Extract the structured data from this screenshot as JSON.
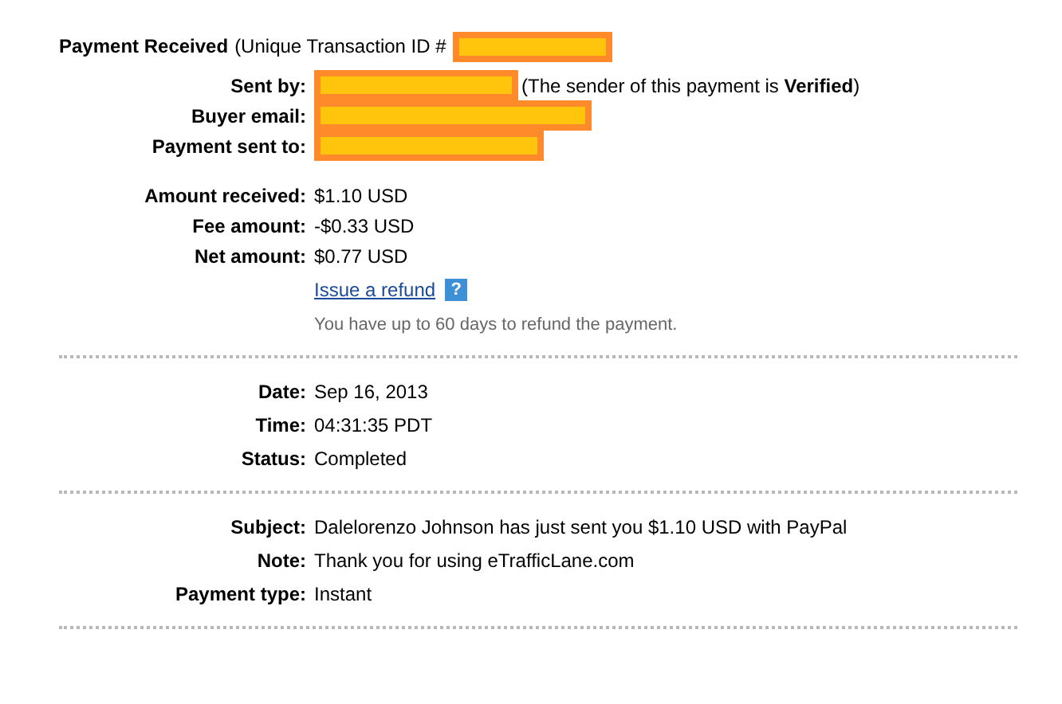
{
  "header": {
    "title": "Payment Received",
    "text": "(Unique Transaction ID #",
    "redacted": true
  },
  "sections": [
    {
      "groups": [
        {
          "rows": [
            {
              "kind": "value",
              "label": "Sent by:",
              "redacted": true,
              "note": "(The sender of this payment is **Verified**)"
            },
            {
              "kind": "value",
              "label": "Buyer email:",
              "redacted": true
            },
            {
              "kind": "value",
              "label": "Payment sent to:",
              "redacted": true
            }
          ]
        },
        {
          "rows": [
            {
              "kind": "value",
              "label": "Amount received:",
              "value": "$1.10 USD"
            },
            {
              "kind": "value",
              "label": "Fee amount:",
              "value": "-$0.33 USD"
            },
            {
              "kind": "value",
              "label": "Net amount:",
              "value": "$0.77 USD"
            },
            {
              "kind": "link",
              "value": "Issue a refund",
              "help": "?"
            },
            {
              "kind": "hint",
              "value": "You have up to 60 days to refund the payment."
            }
          ]
        }
      ]
    },
    {
      "groups": [
        {
          "rows": [
            {
              "kind": "value",
              "label": "Date:",
              "value": "Sep 16, 2013"
            },
            {
              "kind": "value",
              "label": "Time:",
              "value": "04:31:35 PDT"
            },
            {
              "kind": "value",
              "label": "Status:",
              "value": "Completed"
            }
          ]
        }
      ]
    },
    {
      "groups": [
        {
          "rows": [
            {
              "kind": "value",
              "label": "Subject:",
              "value": "Dalelorenzo Johnson has just sent you $1.10 USD with PayPal"
            },
            {
              "kind": "value",
              "label": "Note:",
              "value": "Thank you for using eTrafficLane.com"
            },
            {
              "kind": "value",
              "label": "Payment type:",
              "value": "Instant"
            }
          ]
        }
      ]
    }
  ]
}
